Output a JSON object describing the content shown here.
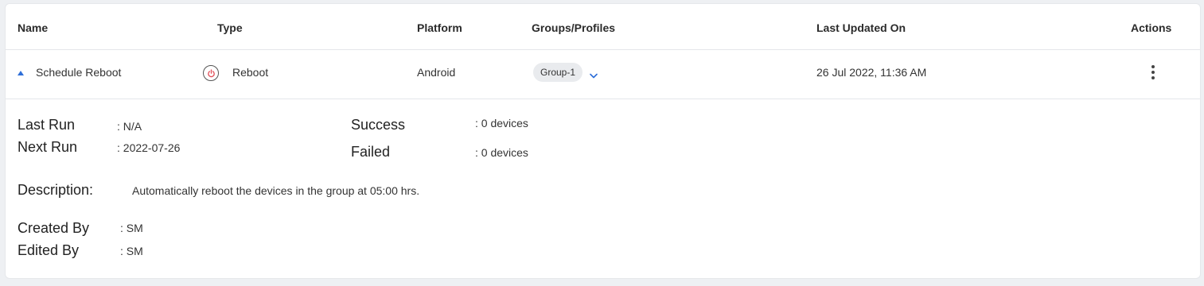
{
  "columns": {
    "name": "Name",
    "type": "Type",
    "platform": "Platform",
    "groups": "Groups/Profiles",
    "updated": "Last Updated On",
    "actions": "Actions"
  },
  "row": {
    "name": "Schedule Reboot",
    "type": "Reboot",
    "platform": "Android",
    "group_badge": "Group-1",
    "updated": "26 Jul 2022, 11:36 AM"
  },
  "details": {
    "last_run_label": "Last Run",
    "last_run_value": ": N/A",
    "next_run_label": "Next Run",
    "next_run_value": ": 2022-07-26",
    "success_label": "Success",
    "success_value": ": 0 devices",
    "failed_label": "Failed",
    "failed_value": ": 0 devices",
    "description_label": "Description:",
    "description_value": "Automatically reboot the devices in the group at 05:00 hrs.",
    "created_by_label": "Created By",
    "created_by_value": ": SM",
    "edited_by_label": "Edited By",
    "edited_by_value": ": SM"
  },
  "icons": {
    "expand": "caret-up-icon",
    "type": "power-icon",
    "dropdown": "chevron-down-icon",
    "actions": "kebab-menu-icon"
  },
  "colors": {
    "accent": "#2f6fd8",
    "power_icon": "#e2525c",
    "badge_bg": "#e9ebee"
  }
}
